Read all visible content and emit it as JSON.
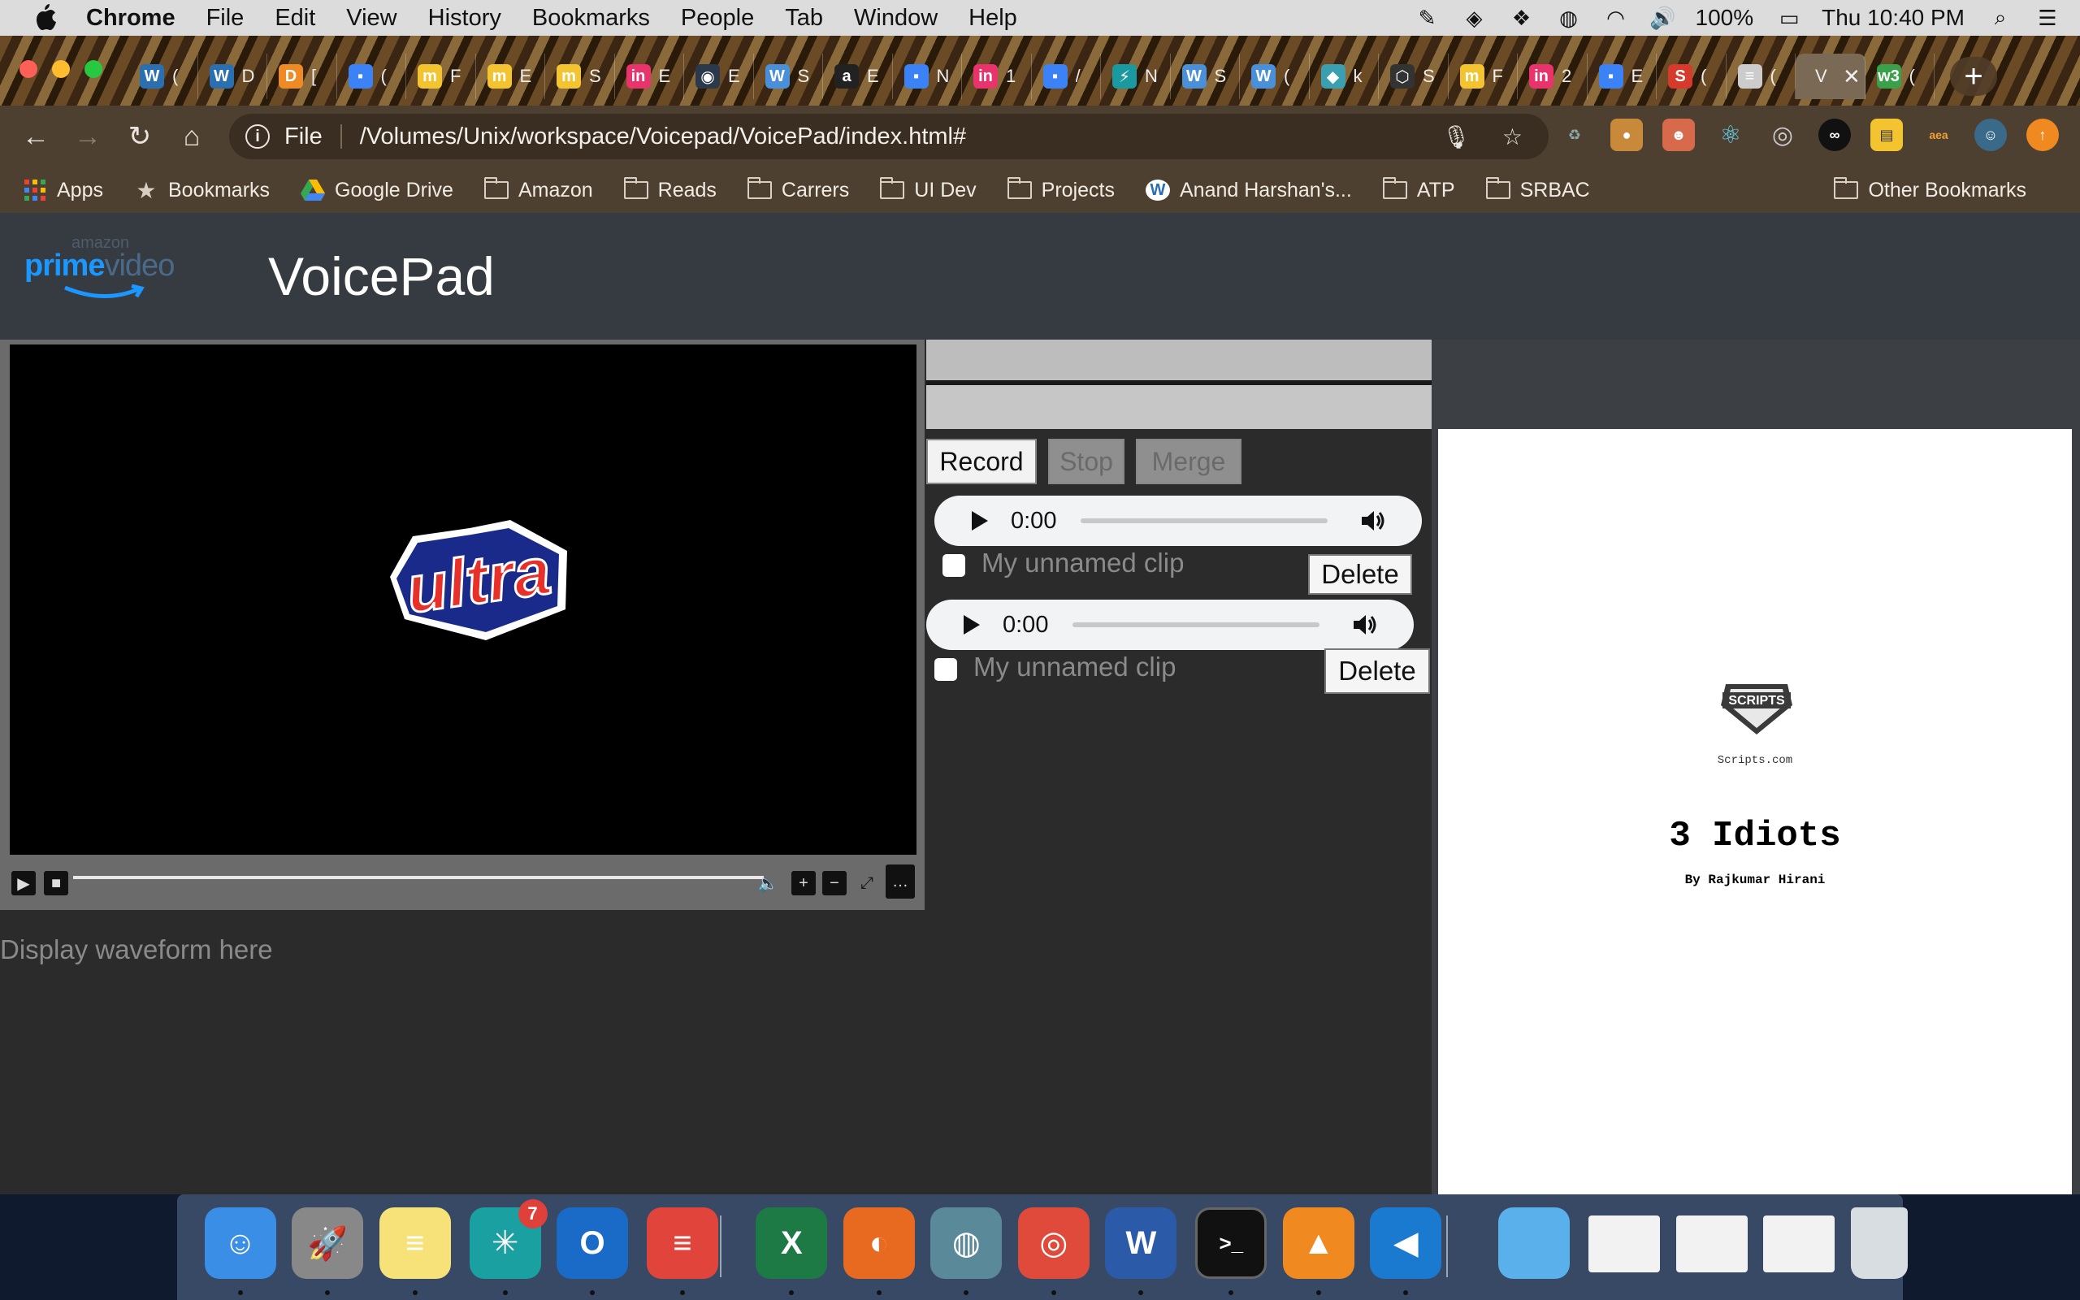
{
  "menubar": {
    "app_name": "Chrome",
    "items": [
      "File",
      "Edit",
      "View",
      "History",
      "Bookmarks",
      "People",
      "Tab",
      "Window",
      "Help"
    ],
    "battery": "100%",
    "clock": "Thu 10:40 PM"
  },
  "tabs": [
    {
      "fav": "W",
      "title": "(",
      "color": "#2a6fb0"
    },
    {
      "fav": "W",
      "title": "D",
      "color": "#2a6fb0"
    },
    {
      "fav": "D",
      "title": "[",
      "color": "#f08a24"
    },
    {
      "fav": "▪",
      "title": "(",
      "color": "#3b82f6"
    },
    {
      "fav": "m",
      "title": "F",
      "color": "#f4c430"
    },
    {
      "fav": "m",
      "title": "E",
      "color": "#f4c430"
    },
    {
      "fav": "m",
      "title": "S",
      "color": "#f4c430"
    },
    {
      "fav": "in",
      "title": "E",
      "color": "#e8336c"
    },
    {
      "fav": "◉",
      "title": "E",
      "color": "#2a3a4a"
    },
    {
      "fav": "W",
      "title": "S",
      "color": "#4a90d9"
    },
    {
      "fav": "a",
      "title": "E",
      "color": "#222222"
    },
    {
      "fav": "▪",
      "title": "N",
      "color": "#3b82f6"
    },
    {
      "fav": "in",
      "title": "1",
      "color": "#e8336c"
    },
    {
      "fav": "▪",
      "title": "/",
      "color": "#3b82f6"
    },
    {
      "fav": "⚡",
      "title": "N",
      "color": "#1a9aa0"
    },
    {
      "fav": "W",
      "title": "S",
      "color": "#4a90d9"
    },
    {
      "fav": "W",
      "title": "(",
      "color": "#4a90d9"
    },
    {
      "fav": "◆",
      "title": "k",
      "color": "#3aa0b0"
    },
    {
      "fav": "⬡",
      "title": "S",
      "color": "#333333"
    },
    {
      "fav": "m",
      "title": "F",
      "color": "#f4c430"
    },
    {
      "fav": "in",
      "title": "2",
      "color": "#e8336c"
    },
    {
      "fav": "▪",
      "title": "E",
      "color": "#3b82f6"
    },
    {
      "fav": "S",
      "title": "(",
      "color": "#d63a2a"
    },
    {
      "fav": "≡",
      "title": "(",
      "color": "#cccccc"
    },
    {
      "fav": "",
      "title": "V",
      "color": "#7a6a55",
      "active": true
    },
    {
      "fav": "w3",
      "title": "(",
      "color": "#3aa04a"
    }
  ],
  "toolbar": {
    "scheme": "File",
    "url": "/Volumes/Unix/workspace/Voicepad/VoicePad/index.html#"
  },
  "bookmarks": {
    "items": [
      {
        "label": "Apps",
        "icon": "apps-grid-icon"
      },
      {
        "label": "Bookmarks",
        "icon": "star-icon"
      },
      {
        "label": "Google Drive",
        "icon": "google-drive-icon"
      },
      {
        "label": "Amazon",
        "icon": "folder-icon"
      },
      {
        "label": "Reads",
        "icon": "folder-icon"
      },
      {
        "label": "Carrers",
        "icon": "folder-icon"
      },
      {
        "label": "UI Dev",
        "icon": "folder-icon"
      },
      {
        "label": "Projects",
        "icon": "folder-icon"
      },
      {
        "label": "Anand Harshan's...",
        "icon": "wordpress-icon"
      },
      {
        "label": "ATP",
        "icon": "folder-icon"
      },
      {
        "label": "SRBAC",
        "icon": "folder-icon"
      }
    ],
    "other": "Other Bookmarks"
  },
  "app": {
    "logo_top": "amazon",
    "logo_prime": "prime",
    "logo_video": "video",
    "title": "VoicePad",
    "video_logo_text": "ultra",
    "waveform_placeholder": "Display waveform here",
    "buttons": {
      "record": "Record",
      "stop": "Stop",
      "merge": "Merge"
    },
    "clips": [
      {
        "time": "0:00",
        "name": "My unnamed clip",
        "delete": "Delete"
      },
      {
        "time": "0:00",
        "name": "My unnamed clip",
        "delete": "Delete"
      }
    ],
    "script": {
      "logo_text": "SCRIPTS",
      "site": "Scripts.com",
      "title": "3 Idiots",
      "author": "By Rajkumar Hirani"
    }
  },
  "dock": {
    "items": [
      {
        "name": "finder",
        "glyph": "☺",
        "color": "#3a8ee6"
      },
      {
        "name": "launchpad",
        "glyph": "🚀",
        "color": "#888888"
      },
      {
        "name": "notes",
        "glyph": "≡",
        "color": "#f7e27a"
      },
      {
        "name": "app-7",
        "glyph": "✳",
        "color": "#1aa0a0",
        "badge": "7"
      },
      {
        "name": "outlook",
        "glyph": "O",
        "color": "#1a6ac8"
      },
      {
        "name": "todoist",
        "glyph": "≡",
        "color": "#e0443a"
      },
      {
        "name": "excel",
        "glyph": "X",
        "color": "#1e7a45"
      },
      {
        "name": "firefox",
        "glyph": "◐",
        "color": "#e86a20"
      },
      {
        "name": "network",
        "glyph": "◍",
        "color": "#5a8a9a"
      },
      {
        "name": "chrome",
        "glyph": "◎",
        "color": "#e04a3a"
      },
      {
        "name": "word",
        "glyph": "W",
        "color": "#2a5aa8"
      },
      {
        "name": "terminal",
        "glyph": ">_",
        "color": "#111111"
      },
      {
        "name": "vlc",
        "glyph": "▲",
        "color": "#f08a20"
      },
      {
        "name": "vscode",
        "glyph": "◀",
        "color": "#1a7ad0"
      },
      {
        "name": "downloads-folder",
        "glyph": "",
        "color": "#5ab0ea"
      },
      {
        "name": "window-word",
        "glyph": "",
        "color": "#f2f2f2"
      },
      {
        "name": "window-todoist",
        "glyph": "",
        "color": "#f2f2f2"
      },
      {
        "name": "window-outlook",
        "glyph": "",
        "color": "#f2f2f2"
      },
      {
        "name": "trash",
        "glyph": "",
        "color": "#d8dde2"
      }
    ]
  }
}
